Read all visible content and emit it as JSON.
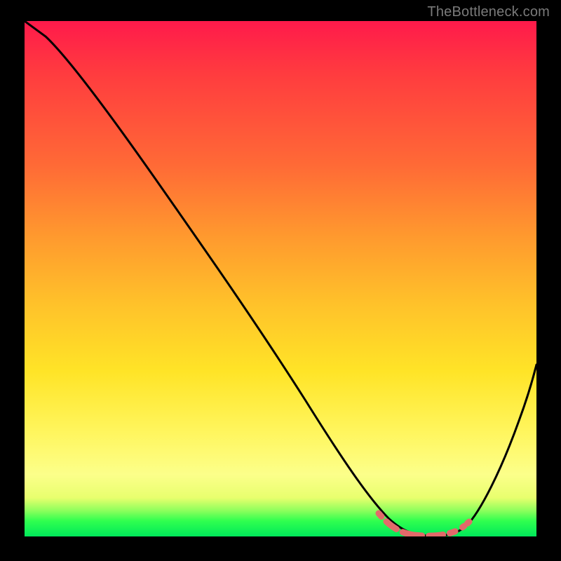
{
  "watermark": "TheBottleneck.com",
  "chart_data": {
    "type": "line",
    "title": "",
    "xlabel": "",
    "ylabel": "",
    "xlim": [
      0,
      100
    ],
    "ylim": [
      0,
      100
    ],
    "grid": false,
    "series": [
      {
        "name": "bottleneck-curve",
        "x": [
          0,
          4,
          10,
          20,
          30,
          40,
          50,
          58,
          62,
          66,
          70,
          74,
          78,
          82,
          86,
          90,
          94,
          100
        ],
        "values": [
          100,
          97,
          92,
          80,
          67,
          54,
          41,
          28,
          18,
          10,
          4,
          1,
          0,
          0,
          2,
          8,
          18,
          40
        ]
      },
      {
        "name": "optimal-marker",
        "x": [
          70,
          72,
          74,
          76,
          78,
          80,
          82,
          84,
          86
        ],
        "values": [
          4,
          2,
          1,
          0,
          0,
          0,
          0,
          0,
          2
        ]
      }
    ],
    "gradient_stops": [
      {
        "pct": 0,
        "color": "#ff1a4b"
      },
      {
        "pct": 28,
        "color": "#ff6a36"
      },
      {
        "pct": 55,
        "color": "#ffc22a"
      },
      {
        "pct": 80,
        "color": "#fff65f"
      },
      {
        "pct": 95,
        "color": "#8cff5c"
      },
      {
        "pct": 100,
        "color": "#00e85a"
      }
    ]
  }
}
